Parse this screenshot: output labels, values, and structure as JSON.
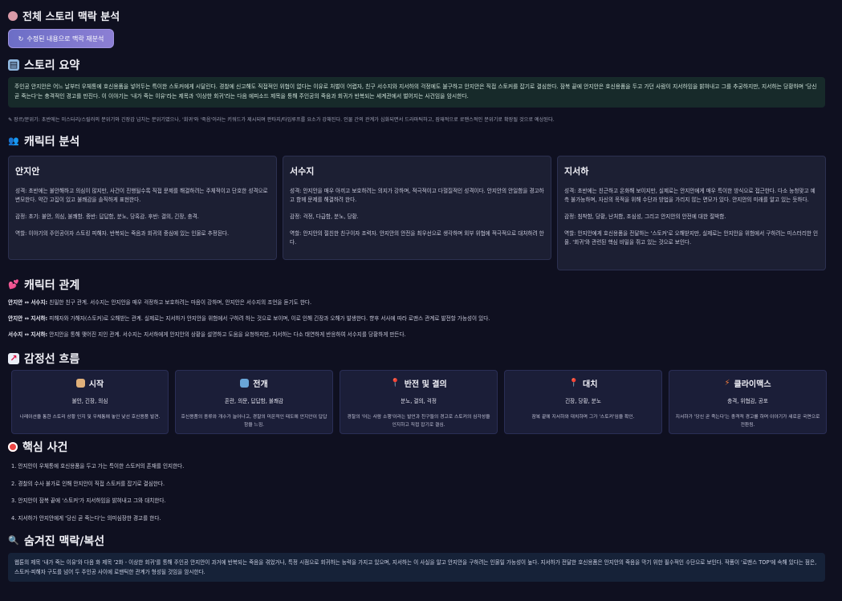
{
  "header": {
    "title": "전체 스토리 맥락 분석",
    "reanalyze_button": "수정된 내용으로 맥락 재분석"
  },
  "summary": {
    "heading": "스토리 요약",
    "text": "주인공 안지안은 어느 날부터 우체통에 호신용품을 넣어두는 특이한 스토커에게 시달린다. 경찰에 신고해도 직접적인 위협이 없다는 이유로 처벌이 어렵자, 친구 서수지와 지서하의 걱정에도 불구하고 안지안은 직접 스토커를 잡기로 결심한다. 잠복 끝에 안지안은 호신용품을 두고 가던 사람이 지서하임을 밝혀내고 그를 추궁하지만, 지서하는 당황하며 '당신 곧 죽는다'는 충격적인 경고를 만진다. 이 이야기는 '내가 죽는 이유'라는 제목과 '이상한 회귀'라는 다음 에피소드 제목을 통해 주인공의 죽음과 회귀가 반복되는 세계관에서 벌어지는 사건임을 암시한다.",
    "note": "장르/분위기: 초반에는 미스터리/스릴러의 분위기와 긴장감 넘치는 분위기였으나, '회귀'와 '죽음'이라는 키워드가 제시되며 판타지/타임루프를 요소가 강해진다. 인물 간의 관계가 심화되면서 드라마틱하고, 잠재적으로 로맨스적인 분위기로 확장될 것으로 예상된다."
  },
  "characters": {
    "heading": "캐릭터 분석",
    "items": [
      {
        "name": "안지안",
        "personality": "성격: 초반에는 불안해하고 의심이 많지만, 사건이 진행될수록 직접 문제를 해결하려는 주체적이고 단호한 성격으로 변모한다. 약간 고집이 있고 불쾌감을 솔직하게 표현한다.",
        "emotion": "감정: 초기: 불안, 의심, 불쾌함. 중반: 답답함, 분노, 당혹감. 후반: 결의, 긴장, 충격.",
        "role": "역할: 이야기의 주인공이자 스토킹 피해자. 반복되는 죽음과 회귀의 중심에 있는 인물로 추정된다."
      },
      {
        "name": "서수지",
        "personality": "성격: 안지안을 매우 아끼고 보호하려는 의지가 강하며, 적극적이고 다혈질적인 성격이다. 안지안의 안일함을 경고하고 함께 문제를 해결하려 한다.",
        "emotion": "감정: 걱정, 다급함, 분노, 당황.",
        "role": "역할: 안지안의 절친한 친구이자 조력자. 안지안의 안전을 최우선으로 생각하며 외부 위협에 적극적으로 대처하려 한다."
      },
      {
        "name": "지서하",
        "personality": "성격: 초반에는 친근하고 온화해 보이지만, 실제로는 안지안에게 매우 특이한 방식으로 접근한다. 다소 능청맞고 예측 불가능하며, 자신의 목적을 위해 수단과 방법을 가리지 않는 면모가 있다. 안지안의 미래를 알고 있는 듯하다.",
        "emotion": "감정: 침착함, 당황, 난처함, 조심성, 그리고 안지안의 안전에 대한 절박함.",
        "role": "역할: 안지안에게 호신용품을 전달하는 '스토커'로 오해받지만, 실제로는 안지안을 위험에서 구하려는 미스터리한 인물. '회귀'와 관련된 핵심 비밀을 쥐고 있는 것으로 보인다."
      }
    ]
  },
  "relations": {
    "heading": "캐릭터 관계",
    "items": [
      {
        "pair": "안지안 ↔ 서수지:",
        "text": "친밀한 친구 관계. 서수지는 안지안을 매우 걱정하고 보호하려는 마음이 강하며, 안지안은 서수지의 조언을 듣기도 한다."
      },
      {
        "pair": "안지안 ↔ 지서하:",
        "text": "피해자와 가해자(스토커)로 오해받는 관계. 실제로는 지서하가 안지안을 위험에서 구하려 하는 것으로 보이며, 이로 인해 긴장과 오해가 발생한다. 향후 서사에 따라 로맨스 관계로 발전할 가능성이 있다."
      },
      {
        "pair": "서수지 ↔ 지서하:",
        "text": "안지안을 통해 맺어진 지인 관계. 서수지는 지서하에게 안지안의 상황을 설명하고 도움을 요청하지만, 지서하는 다소 태연하게 반응하여 서수지를 당황하게 만든다."
      }
    ]
  },
  "emotion_flow": {
    "heading": "감정선 흐름",
    "stages": [
      {
        "title": "시작",
        "emotions": "불안, 긴장, 의심",
        "desc": "나레이션을 통한 스토리 상황 인지 및 우체통에 놓인 낯선 호신용품 발견."
      },
      {
        "title": "전개",
        "emotions": "혼란, 의문, 답답함, 불쾌감",
        "desc": "호신용품의 종류와 개수가 늘어나고, 경찰의 미온적인 태도에 안지안이 답답함을 느낌."
      },
      {
        "title": "반전 및 결의",
        "emotions": "분노, 결의, 걱정",
        "desc": "경찰의 '어는 사람 소행'이라는 발언과 친구들의 경고로 스토커의 심각성을 인지하고 직접 잡기로 결심."
      },
      {
        "title": "대치",
        "emotions": "긴장, 당황, 분노",
        "desc": "잠복 끝에 지서하와 대치하며 그가 '스토커'임을 확인."
      },
      {
        "title": "클라이맥스",
        "emotions": "충격, 위협감, 공포",
        "desc": "지서하가 '당신 곧 죽는다'는 충격적 경고를 하며 이야기가 새로운 국면으로 전환됨."
      }
    ]
  },
  "events": {
    "heading": "핵심 사건",
    "items": [
      "1. 안지안이 우체통에 호신용품을 두고 가는 특이한 스토커의 존재를 인지한다.",
      "2. 경찰의 수사 불가로 인해 안지안이 직접 스토커를 잡기로 결심한다.",
      "3. 안지안이 잠복 끝에 '스토커'가 지서하임을 밝혀내고 그와 대치한다.",
      "4. 지서하가 안지안에게 '당신 곧 죽는다'는 의미심장한 경고를 한다."
    ]
  },
  "hidden": {
    "heading": "숨겨진 맥락/복선",
    "text": "웹툰의 제목 '내가 죽는 이유'와 다음 화 제목 '2화 - 이상한 회귀'를 통해 주인공 안지안이 과거에 반복되는 죽음을 겪었거나, 특정 시점으로 회귀하는 능력을 가지고 있으며, 지서하는 이 사실을 알고 안지안을 구하려는 인물일 가능성이 높다. 지서하가 전달한 호신용품은 안지안의 죽음을 막기 위한 필수적인 수단으로 보인다. 작품이 '로맨스 TOP'에 속해 있다는 점은, 스토커-피해자 구도를 넘어 두 주인공 사이에 로맨틱한 관계가 형성될 것임을 암시한다."
  },
  "colors": {
    "bg": "#0f1020",
    "card": "#1c1f33",
    "summary_bg": "#172a2a",
    "hidden_bg": "#162238",
    "accent": "#7b76cf"
  }
}
